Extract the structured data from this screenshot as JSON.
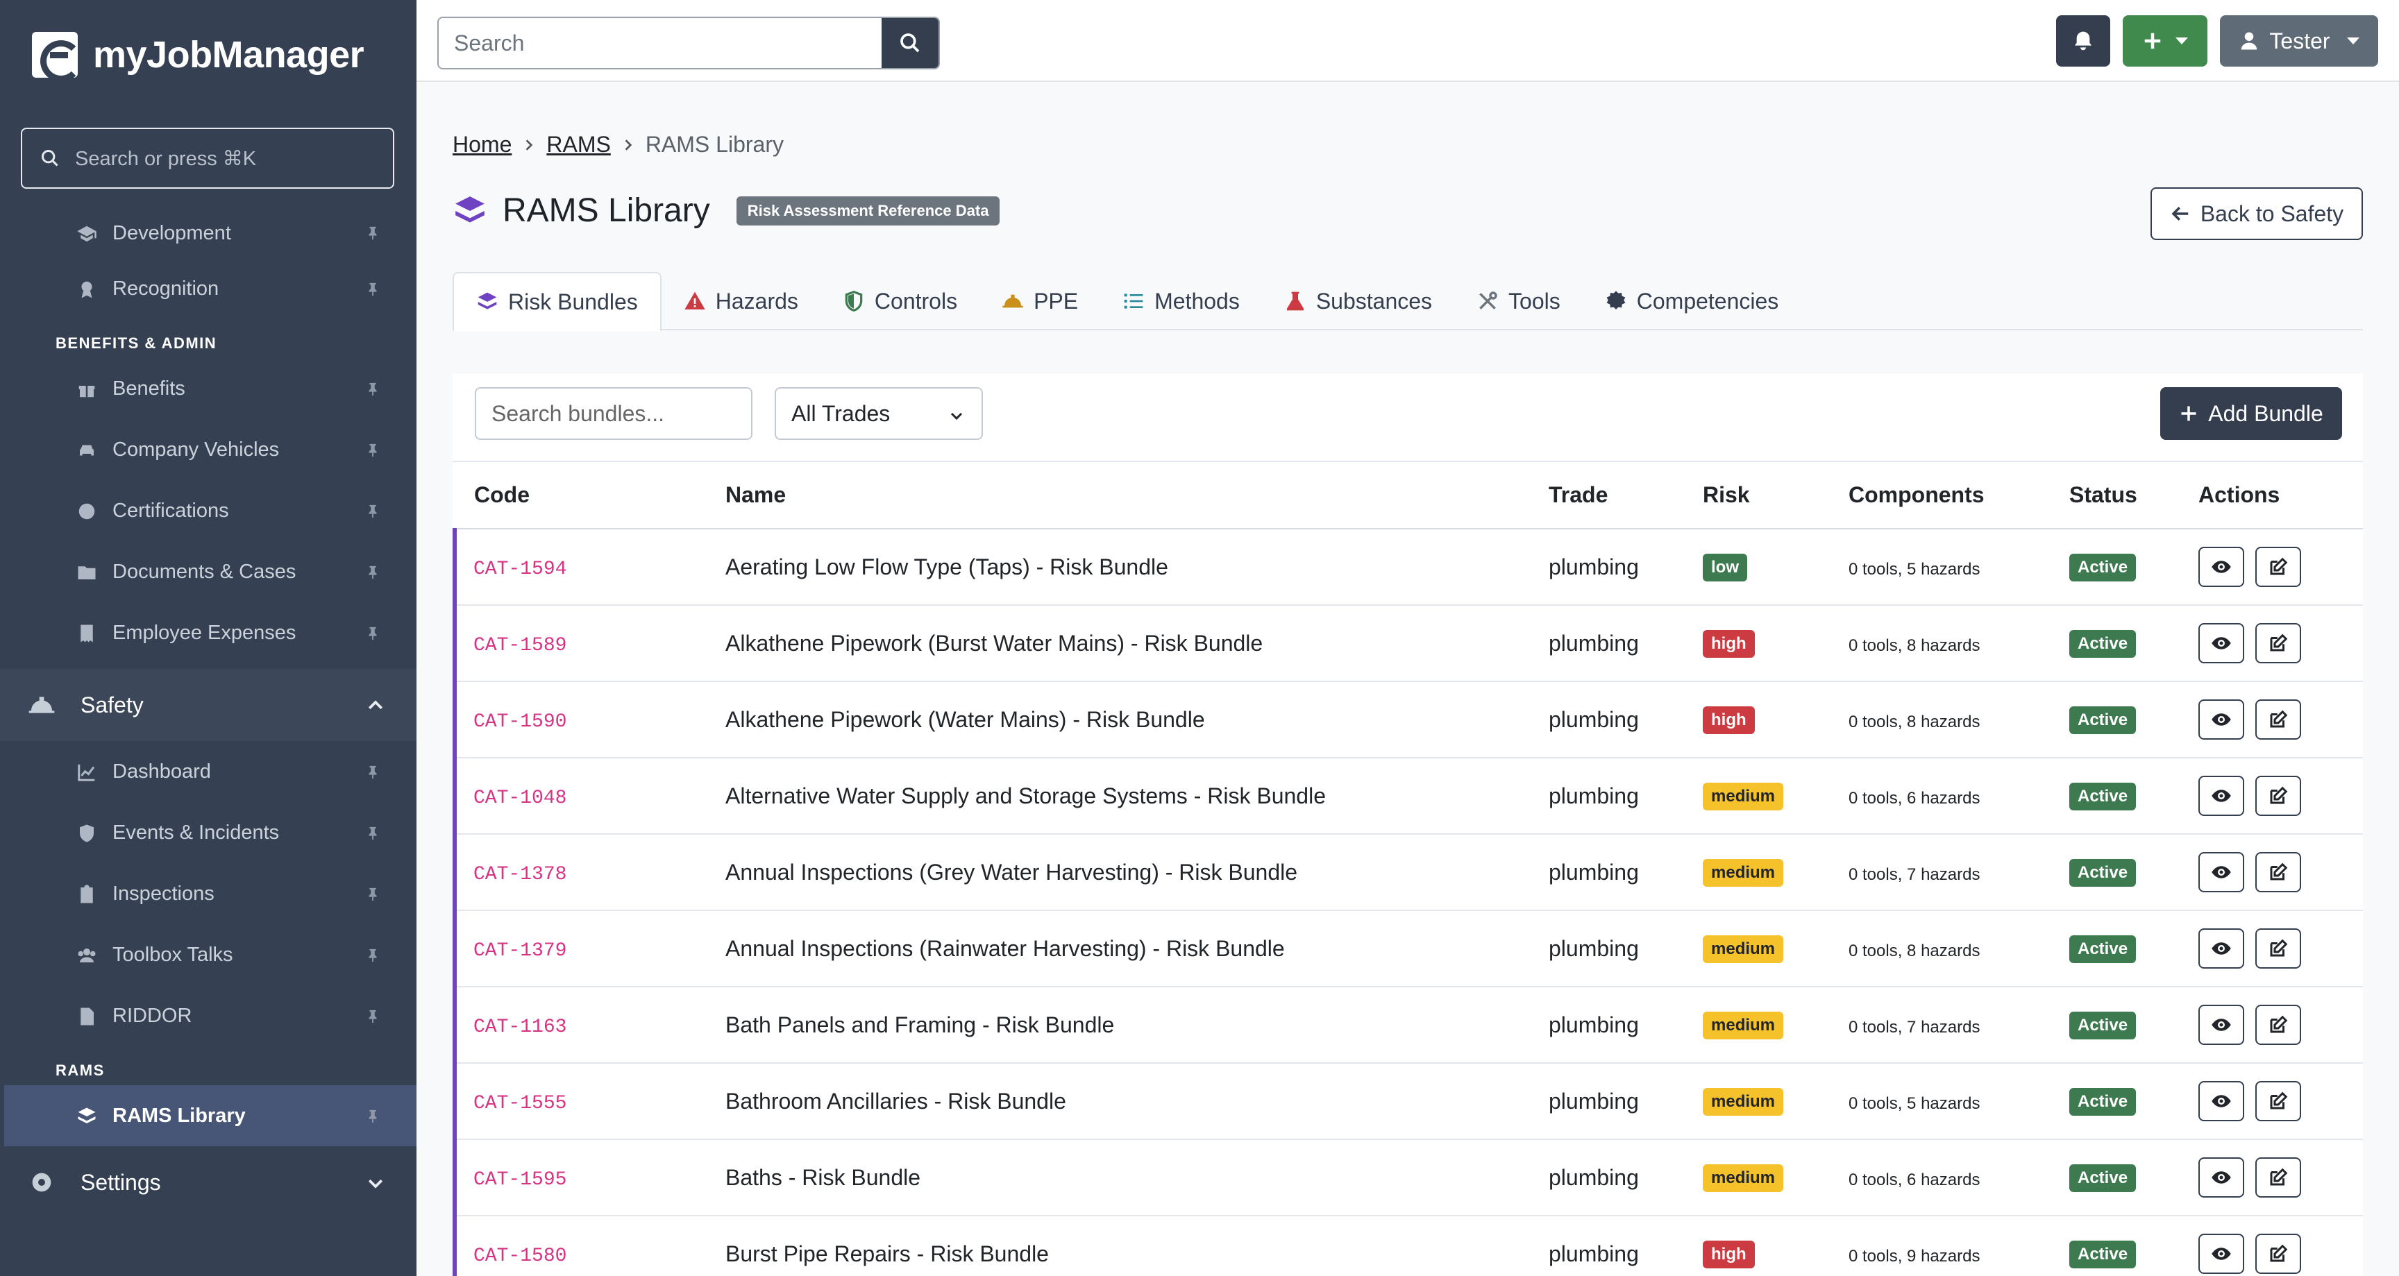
{
  "app": {
    "name": "myJobManager"
  },
  "sidebar": {
    "search_placeholder": "Search or press ⌘K",
    "items_top": [
      {
        "label": "Development",
        "icon": "graduation-cap-icon"
      },
      {
        "label": "Recognition",
        "icon": "award-icon"
      }
    ],
    "heading_benefits": "BENEFITS & ADMIN",
    "items_benefits": [
      {
        "label": "Benefits",
        "icon": "gift-icon"
      },
      {
        "label": "Company Vehicles",
        "icon": "car-icon"
      },
      {
        "label": "Certifications",
        "icon": "certificate-icon"
      },
      {
        "label": "Documents & Cases",
        "icon": "folder-icon"
      },
      {
        "label": "Employee Expenses",
        "icon": "receipt-icon"
      }
    ],
    "group_safety": "Safety",
    "items_safety": [
      {
        "label": "Dashboard",
        "icon": "chart-line-icon"
      },
      {
        "label": "Events & Incidents",
        "icon": "shield-icon"
      },
      {
        "label": "Inspections",
        "icon": "clipboard-check-icon"
      },
      {
        "label": "Toolbox Talks",
        "icon": "users-icon"
      },
      {
        "label": "RIDDOR",
        "icon": "file-icon"
      }
    ],
    "heading_rams": "RAMS",
    "item_rams_library": "RAMS Library",
    "group_settings": "Settings"
  },
  "topbar": {
    "search_placeholder": "Search",
    "user_name": "Tester"
  },
  "breadcrumb": {
    "home": "Home",
    "rams": "RAMS",
    "current": "RAMS Library"
  },
  "page": {
    "title": "RAMS Library",
    "badge": "Risk Assessment Reference Data",
    "back_label": "Back to Safety"
  },
  "tabs": [
    {
      "label": "Risk Bundles",
      "icon": "layers-icon",
      "color": "#6f42c1"
    },
    {
      "label": "Hazards",
      "icon": "warning-icon",
      "color": "#cc3b41"
    },
    {
      "label": "Controls",
      "icon": "shield-icon",
      "color": "#3d7a4f"
    },
    {
      "label": "PPE",
      "icon": "hard-hat-icon",
      "color": "#c9911a"
    },
    {
      "label": "Methods",
      "icon": "list-icon",
      "color": "#2a8a9c"
    },
    {
      "label": "Substances",
      "icon": "flask-icon",
      "color": "#cc3b41"
    },
    {
      "label": "Tools",
      "icon": "tools-icon",
      "color": "#6c757d"
    },
    {
      "label": "Competencies",
      "icon": "certificate-icon",
      "color": "#343e4f"
    }
  ],
  "filters": {
    "search_placeholder": "Search bundles...",
    "trade_selected": "All Trades",
    "add_label": "Add Bundle"
  },
  "table": {
    "headers": [
      "Code",
      "Name",
      "Trade",
      "Risk",
      "Components",
      "Status",
      "Actions"
    ],
    "rows": [
      {
        "code": "CAT-1594",
        "name": "Aerating Low Flow Type (Taps) - Risk Bundle",
        "trade": "plumbing",
        "risk": "low",
        "components": "0 tools, 5 hazards",
        "status": "Active"
      },
      {
        "code": "CAT-1589",
        "name": "Alkathene Pipework (Burst Water Mains) - Risk Bundle",
        "trade": "plumbing",
        "risk": "high",
        "components": "0 tools, 8 hazards",
        "status": "Active"
      },
      {
        "code": "CAT-1590",
        "name": "Alkathene Pipework (Water Mains) - Risk Bundle",
        "trade": "plumbing",
        "risk": "high",
        "components": "0 tools, 8 hazards",
        "status": "Active"
      },
      {
        "code": "CAT-1048",
        "name": "Alternative Water Supply and Storage Systems - Risk Bundle",
        "trade": "plumbing",
        "risk": "medium",
        "components": "0 tools, 6 hazards",
        "status": "Active"
      },
      {
        "code": "CAT-1378",
        "name": "Annual Inspections (Grey Water Harvesting) - Risk Bundle",
        "trade": "plumbing",
        "risk": "medium",
        "components": "0 tools, 7 hazards",
        "status": "Active"
      },
      {
        "code": "CAT-1379",
        "name": "Annual Inspections (Rainwater Harvesting) - Risk Bundle",
        "trade": "plumbing",
        "risk": "medium",
        "components": "0 tools, 8 hazards",
        "status": "Active"
      },
      {
        "code": "CAT-1163",
        "name": "Bath Panels and Framing - Risk Bundle",
        "trade": "plumbing",
        "risk": "medium",
        "components": "0 tools, 7 hazards",
        "status": "Active"
      },
      {
        "code": "CAT-1555",
        "name": "Bathroom Ancillaries - Risk Bundle",
        "trade": "plumbing",
        "risk": "medium",
        "components": "0 tools, 5 hazards",
        "status": "Active"
      },
      {
        "code": "CAT-1595",
        "name": "Baths - Risk Bundle",
        "trade": "plumbing",
        "risk": "medium",
        "components": "0 tools, 6 hazards",
        "status": "Active"
      },
      {
        "code": "CAT-1580",
        "name": "Burst Pipe Repairs - Risk Bundle",
        "trade": "plumbing",
        "risk": "high",
        "components": "0 tools, 9 hazards",
        "status": "Active"
      }
    ]
  }
}
